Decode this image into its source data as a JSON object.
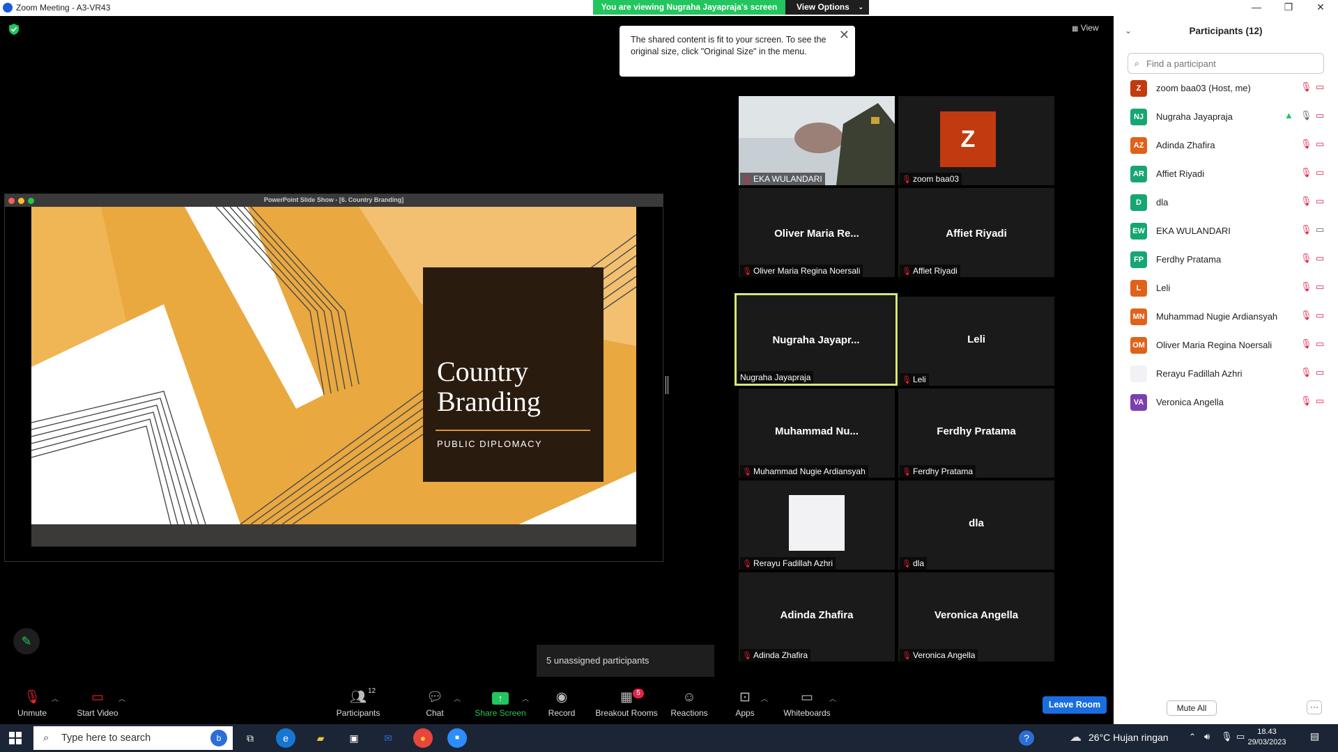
{
  "window": {
    "title": "Zoom Meeting - A3-VR43"
  },
  "banner": {
    "viewing_text": "You are viewing Nugraha Jayapraja's screen",
    "view_options": "View Options"
  },
  "tooltip": {
    "text": "The shared content is fit to your screen. To see the original size, click \"Original Size\" in the menu."
  },
  "view_button": "View",
  "shared": {
    "window_title": "PowerPoint Slide Show - [6. Country Branding]",
    "slide_title": "Country Branding",
    "slide_subtitle": "PUBLIC DIPLOMACY"
  },
  "tiles": [
    {
      "label": "EKA WULANDARI",
      "name": "",
      "kind": "video"
    },
    {
      "label": "zoom baa03",
      "name": "",
      "kind": "avatar",
      "initial": "Z"
    },
    {
      "label": "Oliver Maria Regina Noersali",
      "name": "Oliver Maria Re...",
      "kind": "name"
    },
    {
      "label": "Affiet Riyadi",
      "name": "Affiet Riyadi",
      "kind": "name"
    },
    {
      "label": "Nugraha Jayapraja",
      "name": "Nugraha Jayapr...",
      "kind": "name",
      "active": true
    },
    {
      "label": "Leli",
      "name": "Leli",
      "kind": "name"
    },
    {
      "label": "Muhammad Nugie Ardiansyah",
      "name": "Muhammad Nu...",
      "kind": "name"
    },
    {
      "label": "Ferdhy Pratama",
      "name": "Ferdhy Pratama",
      "kind": "name"
    },
    {
      "label": "Rerayu Fadillah Azhri",
      "name": "",
      "kind": "blank"
    },
    {
      "label": "dla",
      "name": "dla",
      "kind": "name"
    },
    {
      "label": "Adinda Zhafira",
      "name": "Adinda Zhafira",
      "kind": "name"
    },
    {
      "label": "Veronica Angella",
      "name": "Veronica Angella",
      "kind": "name"
    }
  ],
  "unassigned": "5 unassigned participants",
  "toolbar": {
    "unmute": "Unmute",
    "start_video": "Start Video",
    "participants": "Participants",
    "participants_count": "12",
    "chat": "Chat",
    "share_screen": "Share Screen",
    "record": "Record",
    "breakout_rooms": "Breakout Rooms",
    "breakout_badge": "5",
    "reactions": "Reactions",
    "apps": "Apps",
    "whiteboards": "Whiteboards",
    "leave": "Leave Room"
  },
  "panel": {
    "title": "Participants (12)",
    "search_placeholder": "Find a participant",
    "participants": [
      {
        "initials": "Z",
        "name": "zoom baa03 (Host, me)",
        "color": "#c23a0f"
      },
      {
        "initials": "NJ",
        "name": "Nugraha Jayapraja",
        "color": "#17a672"
      },
      {
        "initials": "AZ",
        "name": "Adinda Zhafira",
        "color": "#e0621a"
      },
      {
        "initials": "AR",
        "name": "Affiet Riyadi",
        "color": "#17a672"
      },
      {
        "initials": "D",
        "name": "dla",
        "color": "#17a672"
      },
      {
        "initials": "EW",
        "name": "EKA WULANDARI",
        "color": "#17a672"
      },
      {
        "initials": "FP",
        "name": "Ferdhy Pratama",
        "color": "#17a672"
      },
      {
        "initials": "L",
        "name": "Leli",
        "color": "#e0621a"
      },
      {
        "initials": "MN",
        "name": "Muhammad Nugie Ardiansyah",
        "color": "#e0621a"
      },
      {
        "initials": "OM",
        "name": "Oliver Maria Regina Noersali",
        "color": "#e0621a"
      },
      {
        "initials": "",
        "name": "Rerayu Fadillah Azhri",
        "color": "#f2f2f4"
      },
      {
        "initials": "VA",
        "name": "Veronica Angella",
        "color": "#7b3fb0"
      }
    ],
    "mute_all": "Mute All",
    "more": "···"
  },
  "taskbar": {
    "search_placeholder": "Type here to search",
    "weather": "26°C  Hujan ringan",
    "time": "18.43",
    "date": "29/03/2023"
  }
}
